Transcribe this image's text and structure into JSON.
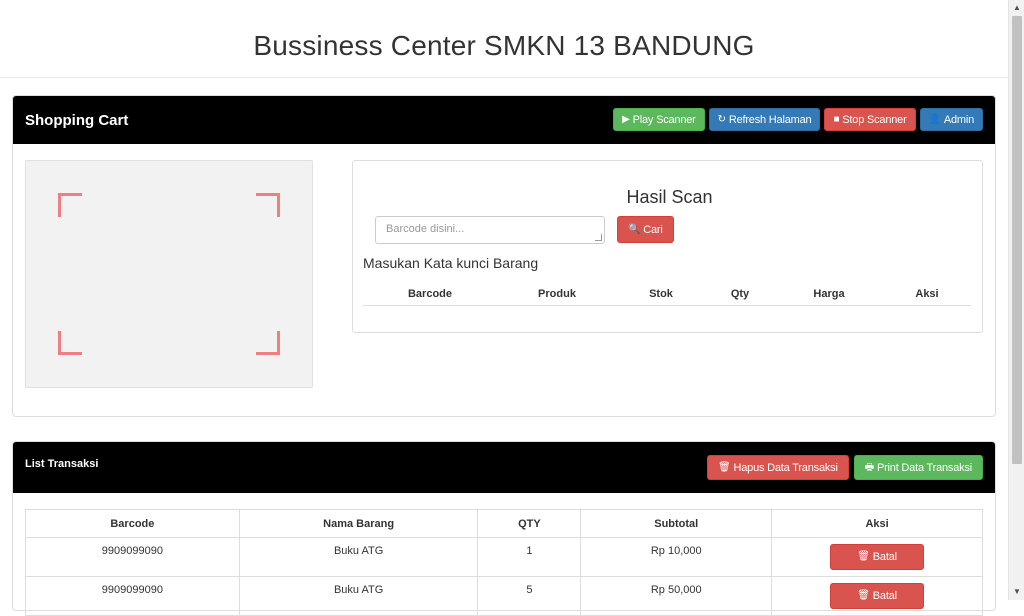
{
  "header": {
    "title": "Bussiness Center SMKN 13 BANDUNG"
  },
  "cart": {
    "title": "Shopping Cart",
    "buttons": {
      "play": {
        "label": "Play Scanner",
        "icon": "play-icon"
      },
      "refresh": {
        "label": "Refresh Halaman",
        "icon": "refresh-icon"
      },
      "stop": {
        "label": "Stop Scanner",
        "icon": "stop-icon"
      },
      "admin": {
        "label": "Admin",
        "icon": "user-icon"
      }
    },
    "result": {
      "title": "Hasil Scan",
      "barcode_placeholder": "Barcode disini...",
      "search_label": "Cari",
      "keyword_label": "Masukan Kata kunci Barang",
      "columns": [
        "Barcode",
        "Produk",
        "Stok",
        "Qty",
        "Harga",
        "Aksi"
      ]
    }
  },
  "transactions": {
    "title": "List Transaksi",
    "delete_label": "Hapus Data Transaksi",
    "print_label": "Print Data Transaksi",
    "columns": [
      "Barcode",
      "Nama Barang",
      "QTY",
      "Subtotal",
      "Aksi"
    ],
    "rows": [
      {
        "barcode": "9909099090",
        "name": "Buku ATG",
        "qty": "1",
        "subtotal": "Rp 10,000",
        "action": "Batal"
      },
      {
        "barcode": "9909099090",
        "name": "Buku ATG",
        "qty": "5",
        "subtotal": "Rp 50,000",
        "action": "Batal"
      }
    ]
  },
  "colors": {
    "success": "#5cb85c",
    "primary": "#337ab7",
    "danger": "#d9534f",
    "scanner_corner": "#f08080"
  }
}
